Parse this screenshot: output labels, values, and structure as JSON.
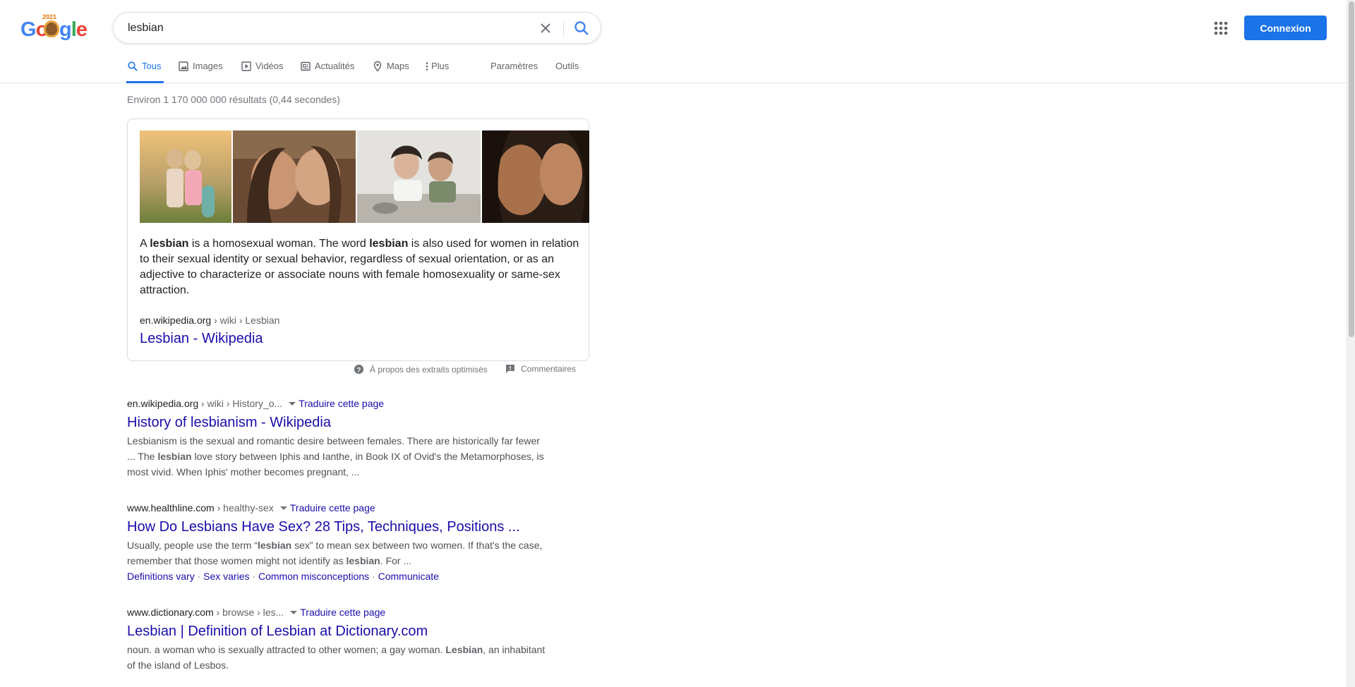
{
  "logo": {
    "doodle_year": "2021",
    "letters": [
      "G",
      "o",
      "o",
      "g",
      "l",
      "e"
    ]
  },
  "search": {
    "query": "lesbian"
  },
  "header": {
    "signin_label": "Connexion"
  },
  "tabs": [
    {
      "label": "Tous",
      "icon": "search-icon"
    },
    {
      "label": "Images",
      "icon": "image-icon"
    },
    {
      "label": "Vidéos",
      "icon": "video-icon"
    },
    {
      "label": "Actualités",
      "icon": "news-icon"
    },
    {
      "label": "Maps",
      "icon": "map-pin-icon"
    },
    {
      "label": "Plus",
      "icon": "more-vert-icon"
    },
    {
      "label": "Paramètres"
    },
    {
      "label": "Outils"
    }
  ],
  "stats": "Environ 1 170 000 000 résultats (0,44 secondes)",
  "featured": {
    "text_parts": [
      "A ",
      "lesbian",
      " is a homosexual woman. The word ",
      "lesbian",
      " is also used for women in relation to their sexual identity or sexual behavior, regardless of sexual orientation, or as an adjective to characterize or associate nouns with female homosexuality or same-sex attraction."
    ],
    "cite_domain": "en.wikipedia.org",
    "cite_path": " › wiki › Lesbian",
    "title": "Lesbian - Wikipedia",
    "footer_about": "À propos des extraits optimisés",
    "footer_feedback": "Commentaires"
  },
  "results": [
    {
      "domain": "en.wikipedia.org",
      "path": " › wiki › History_o...",
      "translate": "Traduire cette page",
      "title": "History of lesbianism - Wikipedia",
      "desc_parts": [
        "Lesbianism is the sexual and romantic desire between females. There are historically far fewer ... The ",
        "lesbian",
        " love story between Iphis and Ianthe, in Book IX of Ovid's the Metamorphoses, is most vivid. When Iphis' mother becomes pregnant, ..."
      ]
    },
    {
      "domain": "www.healthline.com",
      "path": " › healthy-sex",
      "translate": "Traduire cette page",
      "title": "How Do Lesbians Have Sex? 28 Tips, Techniques, Positions ...",
      "desc_parts": [
        "Usually, people use the term “",
        "lesbian",
        " sex” to mean sex between two women. If that's the case, remember that those women might not identify as ",
        "lesbian",
        ". For ..."
      ],
      "sitelinks": [
        "Definitions vary",
        "Sex varies",
        "Common misconceptions",
        "Communicate"
      ]
    },
    {
      "domain": "www.dictionary.com",
      "path": " › browse › les...",
      "translate": "Traduire cette page",
      "title": "Lesbian | Definition of Lesbian at Dictionary.com",
      "desc_parts": [
        "noun. a woman who is sexually attracted to other women; a gay woman. ",
        "Lesbian",
        ", an inhabitant of the island of Lesbos."
      ]
    }
  ],
  "colors": {
    "accent": "#1a73e8",
    "link": "#1a0dab",
    "muted": "#70757a"
  }
}
